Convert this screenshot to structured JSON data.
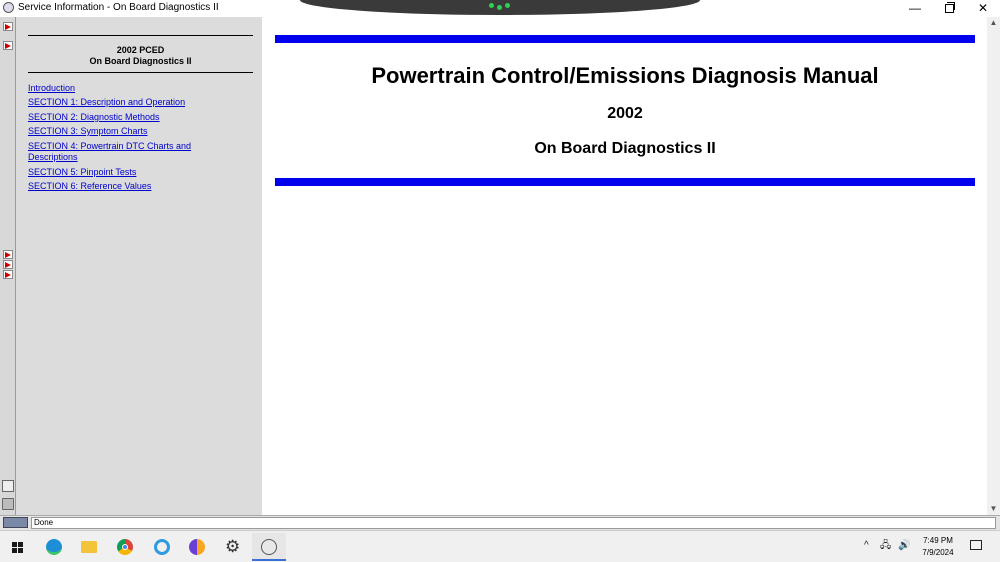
{
  "window": {
    "title": "Service Information - On Board Diagnostics II",
    "minimize_glyph": "—",
    "close_glyph": "✕"
  },
  "toc": {
    "title_line1": "2002 PCED",
    "title_line2": "On Board Diagnostics II",
    "links": [
      "Introduction",
      "SECTION 1: Description and Operation",
      "SECTION 2: Diagnostic Methods",
      "SECTION 3: Symptom Charts",
      "SECTION 4: Powertrain DTC Charts and Descriptions",
      "SECTION 5: Pinpoint Tests",
      "SECTION 6: Reference Values"
    ]
  },
  "main": {
    "heading": "Powertrain Control/Emissions Diagnosis Manual",
    "year": "2002",
    "subheading": "On Board Diagnostics II",
    "bar_color": "#0000ee"
  },
  "scrollbar": {
    "up_glyph": "▲",
    "down_glyph": "▼"
  },
  "status": {
    "text": "Done"
  },
  "taskbar": {
    "tray_chevron": "^",
    "network_glyph": "🖧",
    "volume_glyph": "🔊",
    "time": "7:49 PM",
    "date": "7/9/2024",
    "apps": [
      "windows-icon",
      "edge-icon",
      "file-explorer-icon",
      "chrome-icon",
      "internet-explorer-icon",
      "ccleaner-icon",
      "settings-gear-icon",
      "service-app-icon"
    ]
  }
}
